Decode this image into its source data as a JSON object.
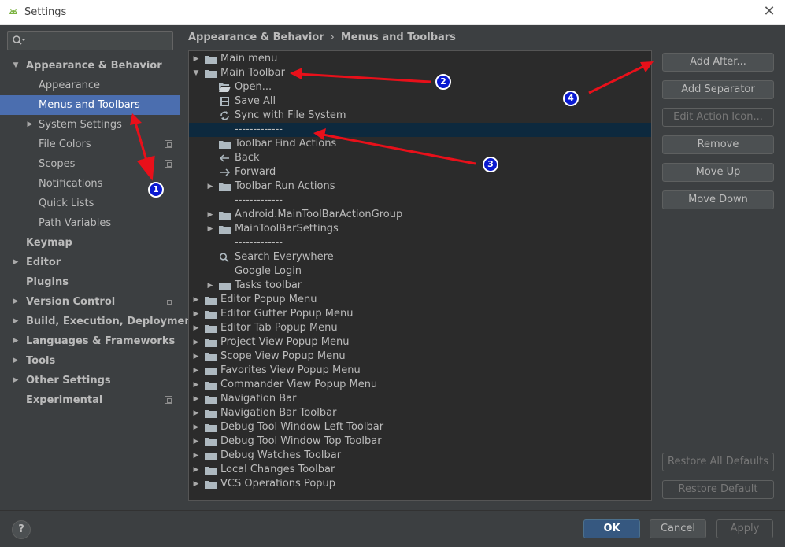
{
  "window": {
    "title": "Settings",
    "close_glyph": "✕"
  },
  "search": {
    "placeholder": ""
  },
  "sidebar": {
    "items": [
      {
        "label": "Appearance & Behavior",
        "level": 0,
        "bold": true,
        "toggle": "expanded"
      },
      {
        "label": "Appearance",
        "level": 1
      },
      {
        "label": "Menus and Toolbars",
        "level": 1,
        "selected": true
      },
      {
        "label": "System Settings",
        "level": 1,
        "toggle": "collapsed"
      },
      {
        "label": "File Colors",
        "level": 1,
        "project_icon": true
      },
      {
        "label": "Scopes",
        "level": 1,
        "project_icon": true
      },
      {
        "label": "Notifications",
        "level": 1
      },
      {
        "label": "Quick Lists",
        "level": 1
      },
      {
        "label": "Path Variables",
        "level": 1
      },
      {
        "label": "Keymap",
        "level": 0,
        "bold": true
      },
      {
        "label": "Editor",
        "level": 0,
        "bold": true,
        "toggle": "collapsed"
      },
      {
        "label": "Plugins",
        "level": 0,
        "bold": true
      },
      {
        "label": "Version Control",
        "level": 0,
        "bold": true,
        "toggle": "collapsed",
        "project_icon": true
      },
      {
        "label": "Build, Execution, Deployment",
        "level": 0,
        "bold": true,
        "toggle": "collapsed"
      },
      {
        "label": "Languages & Frameworks",
        "level": 0,
        "bold": true,
        "toggle": "collapsed"
      },
      {
        "label": "Tools",
        "level": 0,
        "bold": true,
        "toggle": "collapsed"
      },
      {
        "label": "Other Settings",
        "level": 0,
        "bold": true,
        "toggle": "collapsed"
      },
      {
        "label": "Experimental",
        "level": 0,
        "bold": true,
        "project_icon": true
      }
    ]
  },
  "breadcrumb": {
    "parent": "Appearance & Behavior",
    "separator": "›",
    "current": "Menus and Toolbars"
  },
  "tree": {
    "rows": [
      {
        "label": "Main menu",
        "level": 0,
        "toggle": "collapsed",
        "icon": "folder-icon"
      },
      {
        "label": "Main Toolbar",
        "level": 0,
        "toggle": "expanded",
        "icon": "folder-icon"
      },
      {
        "label": "Open...",
        "level": 1,
        "icon": "open-folder-icon"
      },
      {
        "label": "Save All",
        "level": 1,
        "icon": "save-icon"
      },
      {
        "label": "Sync with File System",
        "level": 1,
        "icon": "sync-icon"
      },
      {
        "label": "-------------",
        "level": 1,
        "selected": true
      },
      {
        "label": "Toolbar Find Actions",
        "level": 1,
        "icon": "folder-icon"
      },
      {
        "label": "Back",
        "level": 1,
        "icon": "back-arrow-icon"
      },
      {
        "label": "Forward",
        "level": 1,
        "icon": "forward-arrow-icon"
      },
      {
        "label": "Toolbar Run Actions",
        "level": 1,
        "toggle": "collapsed",
        "icon": "folder-icon"
      },
      {
        "label": "-------------",
        "level": 1
      },
      {
        "label": "Android.MainToolBarActionGroup",
        "level": 1,
        "toggle": "collapsed",
        "icon": "folder-icon"
      },
      {
        "label": "MainToolBarSettings",
        "level": 1,
        "toggle": "collapsed",
        "icon": "folder-icon"
      },
      {
        "label": "-------------",
        "level": 1
      },
      {
        "label": "Search Everywhere",
        "level": 1,
        "icon": "search-icon"
      },
      {
        "label": "Google Login",
        "level": 1
      },
      {
        "label": "Tasks toolbar",
        "level": 1,
        "toggle": "collapsed",
        "icon": "folder-icon"
      },
      {
        "label": "Editor Popup Menu",
        "level": 0,
        "toggle": "collapsed",
        "icon": "folder-icon"
      },
      {
        "label": "Editor Gutter Popup Menu",
        "level": 0,
        "toggle": "collapsed",
        "icon": "folder-icon"
      },
      {
        "label": "Editor Tab Popup Menu",
        "level": 0,
        "toggle": "collapsed",
        "icon": "folder-icon"
      },
      {
        "label": "Project View Popup Menu",
        "level": 0,
        "toggle": "collapsed",
        "icon": "folder-icon"
      },
      {
        "label": "Scope View Popup Menu",
        "level": 0,
        "toggle": "collapsed",
        "icon": "folder-icon"
      },
      {
        "label": "Favorites View Popup Menu",
        "level": 0,
        "toggle": "collapsed",
        "icon": "folder-icon"
      },
      {
        "label": "Commander View Popup Menu",
        "level": 0,
        "toggle": "collapsed",
        "icon": "folder-icon"
      },
      {
        "label": "Navigation Bar",
        "level": 0,
        "toggle": "collapsed",
        "icon": "folder-icon"
      },
      {
        "label": "Navigation Bar Toolbar",
        "level": 0,
        "toggle": "collapsed",
        "icon": "folder-icon"
      },
      {
        "label": "Debug Tool Window Left Toolbar",
        "level": 0,
        "toggle": "collapsed",
        "icon": "folder-icon"
      },
      {
        "label": "Debug Tool Window Top Toolbar",
        "level": 0,
        "toggle": "collapsed",
        "icon": "folder-icon"
      },
      {
        "label": "Debug Watches Toolbar",
        "level": 0,
        "toggle": "collapsed",
        "icon": "folder-icon"
      },
      {
        "label": "Local Changes Toolbar",
        "level": 0,
        "toggle": "collapsed",
        "icon": "folder-icon"
      },
      {
        "label": "VCS Operations Popup",
        "level": 0,
        "toggle": "collapsed",
        "icon": "folder-icon"
      }
    ]
  },
  "actions": {
    "add_after": "Add After...",
    "add_separator": "Add Separator",
    "edit_action_icon": "Edit Action Icon...",
    "remove": "Remove",
    "move_up": "Move Up",
    "move_down": "Move Down",
    "restore_all_defaults": "Restore All Defaults",
    "restore_default": "Restore Default"
  },
  "footer": {
    "help": "?",
    "ok": "OK",
    "cancel": "Cancel",
    "apply": "Apply"
  },
  "annotations": {
    "badge_1": "1",
    "badge_2": "2",
    "badge_3": "3",
    "badge_4": "4",
    "arrow_color": "#e8101a",
    "badge_color": "#0a1ad0"
  },
  "colors": {
    "selection": "#4b6eaf",
    "tree_selection": "#0d293e",
    "ok_button": "#365880"
  }
}
